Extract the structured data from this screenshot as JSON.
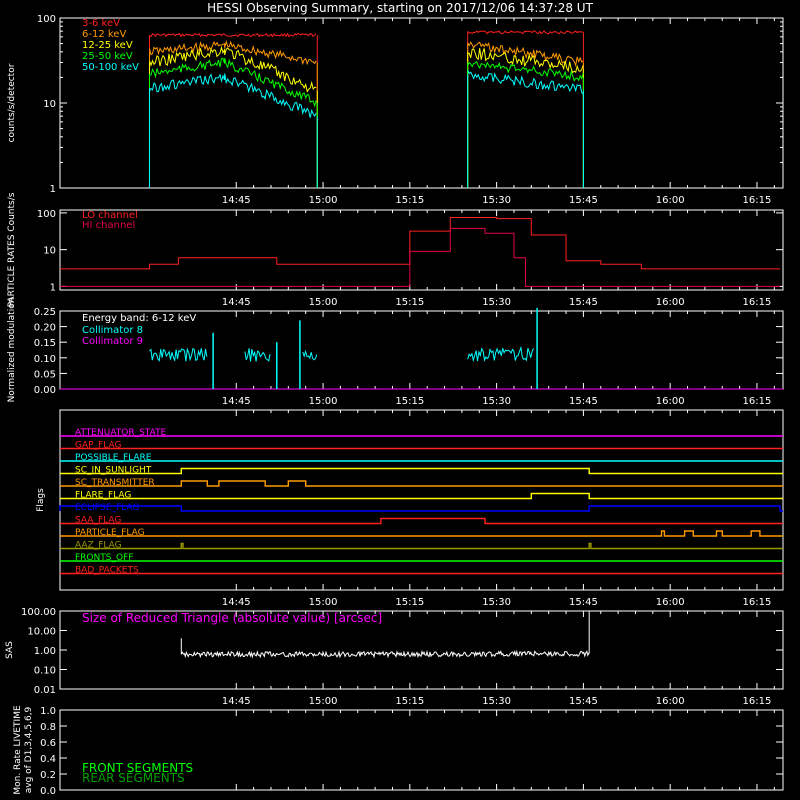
{
  "title": "HESSI Observing Summary, starting on 2017/12/06 14:37:28 UT",
  "time_ticks": [
    "14:45",
    "15:00",
    "15:15",
    "15:30",
    "15:45",
    "16:00",
    "16:15"
  ],
  "colors": {
    "axis": "#ffffff",
    "red": "#ff2020",
    "orange": "#ff9a00",
    "yellow": "#ffff00",
    "green": "#00ff00",
    "cyan": "#00ffff",
    "magenta": "#ff00ff",
    "blue": "#0000ff",
    "crimson": "#e0004a",
    "olive": "#9a9a00",
    "dkgreen": "#00a000"
  },
  "chart_data": [
    {
      "type": "line",
      "name": "count_rates",
      "ylabel": "counts/s/detector",
      "yscale": "log",
      "ylim": [
        1,
        100
      ],
      "yticks": [
        "1",
        "10",
        "100"
      ],
      "xlim_minutes": [
        14.5333,
        103.7
      ],
      "series": [
        {
          "name": "3-6 keV",
          "color": "red",
          "segments": [
            [
              [
                30,
                63
              ],
              [
                59,
                63
              ]
            ],
            [
              [
                85,
                68
              ],
              [
                105,
                68
              ]
            ]
          ]
        },
        {
          "name": "6-12 keV",
          "color": "orange",
          "segments": [
            [
              [
                30,
                40
              ],
              [
                43,
                48
              ],
              [
                59,
                30
              ]
            ],
            [
              [
                85,
                50
              ],
              [
                105,
                30
              ]
            ]
          ]
        },
        {
          "name": "12-25 keV",
          "color": "yellow",
          "segments": [
            [
              [
                30,
                30
              ],
              [
                43,
                42
              ],
              [
                59,
                14
              ]
            ],
            [
              [
                85,
                40
              ],
              [
                105,
                25
              ]
            ]
          ]
        },
        {
          "name": "25-50 keV",
          "color": "green",
          "segments": [
            [
              [
                30,
                22
              ],
              [
                43,
                30
              ],
              [
                59,
                10
              ]
            ],
            [
              [
                85,
                30
              ],
              [
                105,
                20
              ]
            ]
          ]
        },
        {
          "name": "50-100 keV",
          "color": "cyan",
          "segments": [
            [
              [
                30,
                15
              ],
              [
                43,
                20
              ],
              [
                59,
                7
              ]
            ],
            [
              [
                85,
                22
              ],
              [
                105,
                14
              ]
            ]
          ]
        }
      ]
    },
    {
      "type": "line",
      "name": "particle_rates",
      "ylabel": "PARTICLE RATES Counts/s",
      "yscale": "log",
      "ylim": [
        0.8,
        120
      ],
      "yticks": [
        "1",
        "10",
        "100"
      ],
      "series": [
        {
          "name": "LO channel",
          "color": "red",
          "points": [
            [
              14.53,
              3
            ],
            [
              25,
              3
            ],
            [
              30,
              4
            ],
            [
              35,
              6
            ],
            [
              45,
              6
            ],
            [
              52,
              4
            ],
            [
              63,
              4
            ],
            [
              68,
              4
            ],
            [
              75,
              32
            ],
            [
              82,
              75
            ],
            [
              90,
              70
            ],
            [
              96,
              25
            ],
            [
              102,
              5
            ],
            [
              108,
              4
            ],
            [
              115,
              3
            ],
            [
              125,
              3
            ],
            [
              133,
              3
            ],
            [
              139,
              3
            ]
          ]
        },
        {
          "name": "HI channel",
          "color": "crimson",
          "points": [
            [
              14.53,
              1
            ],
            [
              69,
              1
            ],
            [
              75,
              9
            ],
            [
              82,
              38
            ],
            [
              88,
              28
            ],
            [
              93,
              6
            ],
            [
              95,
              1
            ],
            [
              139,
              1
            ]
          ]
        }
      ]
    },
    {
      "type": "line",
      "name": "modulation",
      "ylabel": "Normalized modulation",
      "ylim": [
        0,
        0.25
      ],
      "yticks": [
        "0.00",
        "0.05",
        "0.10",
        "0.15",
        "0.20",
        "0.25"
      ],
      "annotation": "Energy band: 6-12 keV",
      "series": [
        {
          "name": "Collimator 8",
          "color": "cyan",
          "segments": [
            [
              [
                30,
                0.11
              ],
              [
                40,
                0.11
              ]
            ],
            [
              [
                41,
                0.18
              ],
              [
                41,
                0.0
              ]
            ],
            [
              [
                46.5,
                0.11
              ],
              [
                51,
                0.11
              ]
            ],
            [
              [
                52,
                0.15
              ],
              [
                52,
                0.0
              ]
            ],
            [
              [
                56.5,
                0.11
              ],
              [
                59,
                0.11
              ]
            ],
            [
              [
                85,
                0.11
              ],
              [
                96.5,
                0.11
              ]
            ]
          ],
          "spikes": [
            [
              41,
              0.18
            ],
            [
              52,
              0.15
            ],
            [
              56,
              0.22
            ],
            [
              97,
              0.26
            ]
          ]
        },
        {
          "name": "Collimator 9",
          "color": "magenta",
          "flat": 0.0
        }
      ]
    },
    {
      "type": "table",
      "name": "flags",
      "ylabel": "Flags",
      "rows": [
        {
          "label": "ATTENUATOR_STATE",
          "color": "magenta",
          "on": []
        },
        {
          "label": "GAP_FLAG",
          "color": "red",
          "on": []
        },
        {
          "label": "POSSIBLE_FLARE",
          "color": "cyan",
          "on": []
        },
        {
          "label": "SC_IN_SUNLIGHT",
          "color": "yellow",
          "on": [
            [
              35.5,
              106
            ]
          ]
        },
        {
          "label": "SC_TRANSMITTER",
          "color": "orange",
          "on": [
            [
              35.5,
              40
            ],
            [
              42,
              50
            ],
            [
              54,
              57
            ]
          ]
        },
        {
          "label": "FLARE_FLAG",
          "color": "yellow",
          "on": [
            [
              96,
              106
            ]
          ]
        },
        {
          "label": "ECLIPSE_FLAG",
          "color": "blue",
          "on": [
            [
              14.53,
              35.5
            ],
            [
              106,
              139
            ]
          ]
        },
        {
          "label": "SAA_FLAG",
          "color": "red",
          "on": [
            [
              70,
              88
            ]
          ]
        },
        {
          "label": "PARTICLE_FLAG",
          "color": "orange",
          "on": [
            [
              118.5,
              119
            ],
            [
              122.5,
              124
            ],
            [
              128,
              129
            ],
            [
              134,
              135.5
            ]
          ]
        },
        {
          "label": "AAZ_FLAG",
          "color": "olive",
          "on": [
            [
              35.5,
              35.8
            ],
            [
              106,
              106.3
            ]
          ]
        },
        {
          "label": "FRONTS_OFF",
          "color": "green",
          "on": []
        },
        {
          "label": "BAD_PACKETS",
          "color": "red",
          "on": []
        }
      ]
    },
    {
      "type": "line",
      "name": "sas",
      "ylabel": "SAS",
      "yscale": "log",
      "ylim": [
        0.01,
        100
      ],
      "yticks": [
        "0.01",
        "0.10",
        "1.00",
        "10.00",
        "100.00"
      ],
      "annotation": "Size of Reduced Triangle (absolute value) [arcsec]",
      "series": [
        {
          "name": "SAS",
          "color": "axis",
          "points": [
            [
              35.5,
              0.6
            ],
            [
              60,
              0.6
            ],
            [
              80,
              0.62
            ],
            [
              106,
              0.65
            ]
          ]
        }
      ]
    },
    {
      "type": "line",
      "name": "monitor_livetime",
      "ylabel": "Mon. Rate LIVETIME avg of D1,3,4,5,6,9",
      "ylim": [
        0,
        1
      ],
      "yticks": [
        "0.0",
        "0.2",
        "0.4",
        "0.6",
        "0.8",
        "1.0"
      ],
      "series": [
        {
          "name": "FRONT SEGMENTS",
          "color": "green"
        },
        {
          "name": "REAR SEGMENTS",
          "color": "dkgreen"
        }
      ]
    }
  ]
}
